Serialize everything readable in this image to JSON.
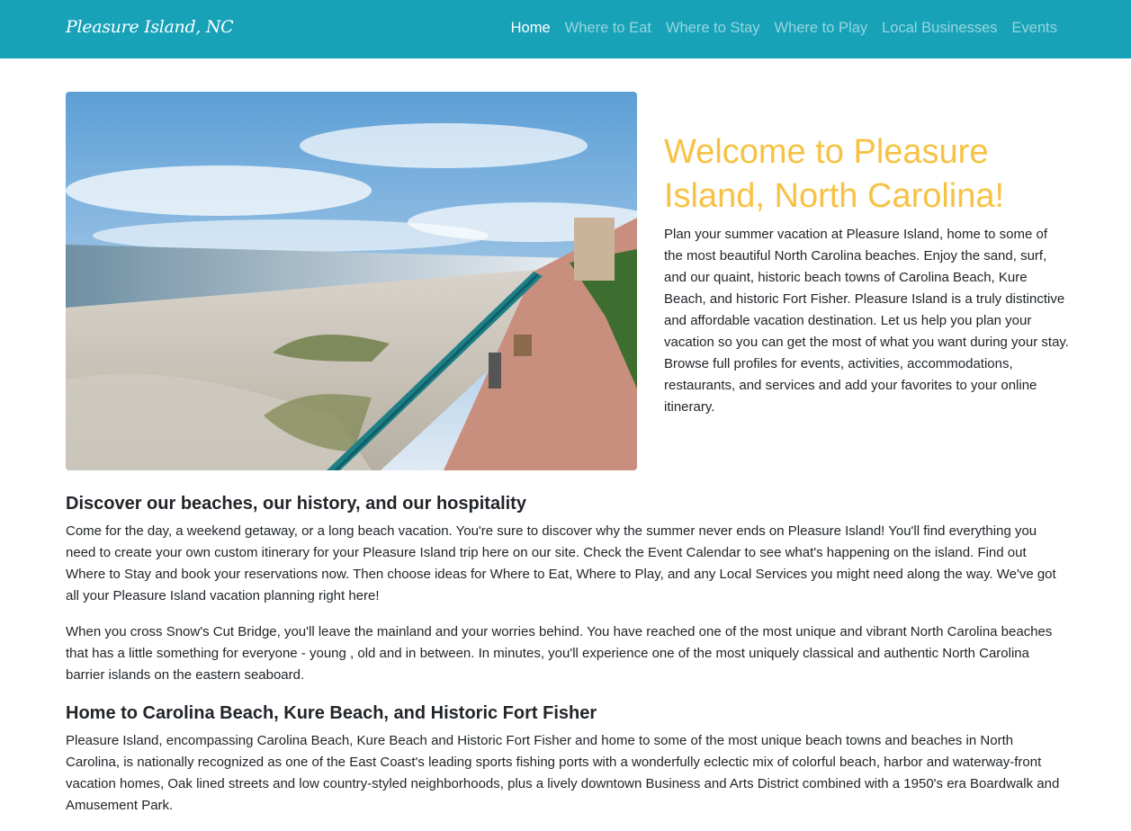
{
  "navbar": {
    "brand": "Pleasure Island, NC",
    "links": [
      {
        "label": "Home",
        "active": true
      },
      {
        "label": "Where to Eat",
        "active": false
      },
      {
        "label": "Where to Stay",
        "active": false
      },
      {
        "label": "Where to Play",
        "active": false
      },
      {
        "label": "Local Businesses",
        "active": false
      },
      {
        "label": "Events",
        "active": false
      }
    ]
  },
  "hero": {
    "title": "Welcome to Pleasure Island, North Carolina!",
    "intro": "Plan your summer vacation at Pleasure Island, home to some of the most beautiful North Carolina beaches. Enjoy the sand, surf, and our quaint, historic beach towns of Carolina Beach, Kure Beach, and historic Fort Fisher. Pleasure Island is a truly distinctive and affordable vacation destination.  Let us help you plan your vacation so you can get the most of what you want during your stay.  Browse full profiles for events, activities, accommodations, restaurants, and services and add your favorites to your online itinerary."
  },
  "sections": [
    {
      "heading": "Discover our beaches, our history, and our hospitality",
      "paragraphs": [
        "Come for the day, a weekend getaway, or a long beach vacation. You're sure to discover why the summer never ends on Pleasure Island! You'll find everything you need to create your own custom itinerary for your Pleasure Island trip here on our site. Check the Event Calendar to see what's happening on the island. Find out Where to Stay and book your reservations now. Then choose ideas for Where to Eat, Where to Play, and any Local Services you might need along the way. We've got all your Pleasure Island vacation planning right here!",
        "When you cross Snow's Cut Bridge, you'll leave the mainland and your worries behind. You have reached one of the most unique and vibrant North Carolina beaches that has a little something for everyone - young , old and in between. In minutes, you'll experience one of the most uniquely classical and authentic North Carolina barrier islands on the eastern seaboard."
      ]
    },
    {
      "heading": "Home to Carolina Beach, Kure Beach, and Historic Fort Fisher",
      "paragraphs": [
        "Pleasure Island, encompassing Carolina Beach, Kure Beach and Historic Fort Fisher and home to some of the most unique beach towns and beaches in North Carolina, is nationally recognized as one of the East Coast's leading sports fishing ports with a wonderfully eclectic mix of colorful beach, harbor and waterway-front vacation homes, Oak lined streets and low country-styled neighborhoods, plus a lively downtown Business and Arts District combined with a 1950's era Boardwalk and Amusement Park."
      ]
    }
  ],
  "colors": {
    "navbar_bg": "#17a2b8",
    "title_color": "#f7c244"
  }
}
